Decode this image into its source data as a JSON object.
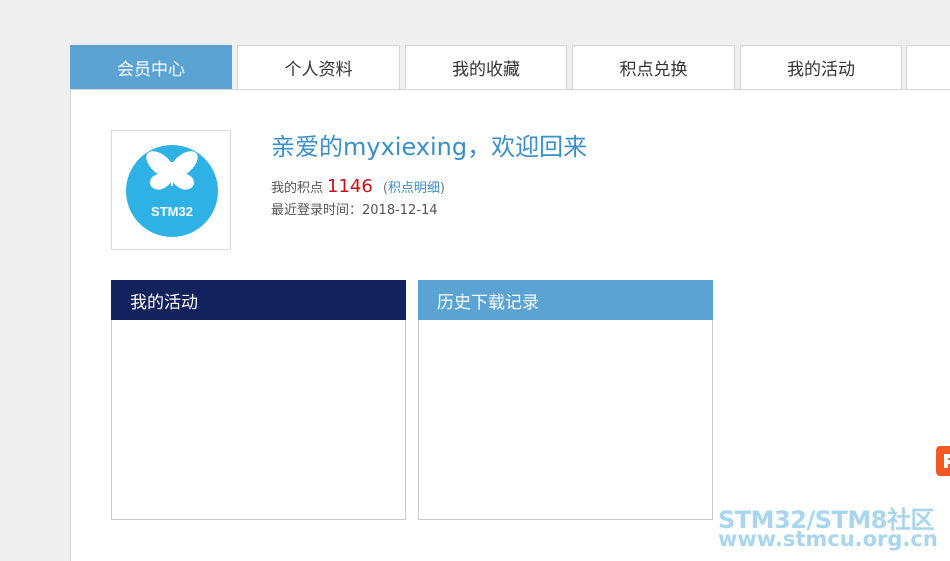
{
  "tabs": [
    {
      "label": "会员中心",
      "active": true
    },
    {
      "label": "个人资料",
      "active": false
    },
    {
      "label": "我的收藏",
      "active": false
    },
    {
      "label": "积点兑换",
      "active": false
    },
    {
      "label": "我的活动",
      "active": false
    }
  ],
  "profile": {
    "avatar_text": "STM32",
    "welcome": "亲爱的myxiexing，欢迎回来",
    "points_label": "我的积点",
    "points_value": "1146",
    "points_open_paren": "(",
    "points_link": "积点明细",
    "points_close_paren": ")",
    "last_login_label": "最近登录时间：",
    "last_login_value": "2018-12-14"
  },
  "boxes": {
    "activity_title": "我的活动",
    "download_title": "历史下载记录"
  },
  "watermark": {
    "line1": "STM32/STM8社区",
    "line2": "www.stmcu.org.cn"
  },
  "colors": {
    "tab_active": "#5aa3d3",
    "activity_header": "#13215c",
    "download_header": "#5aa3d3",
    "points_value": "#c8101a",
    "link": "#3b8fc9",
    "avatar_circle": "#2eb2e6",
    "side_widget": "#f05a22"
  }
}
